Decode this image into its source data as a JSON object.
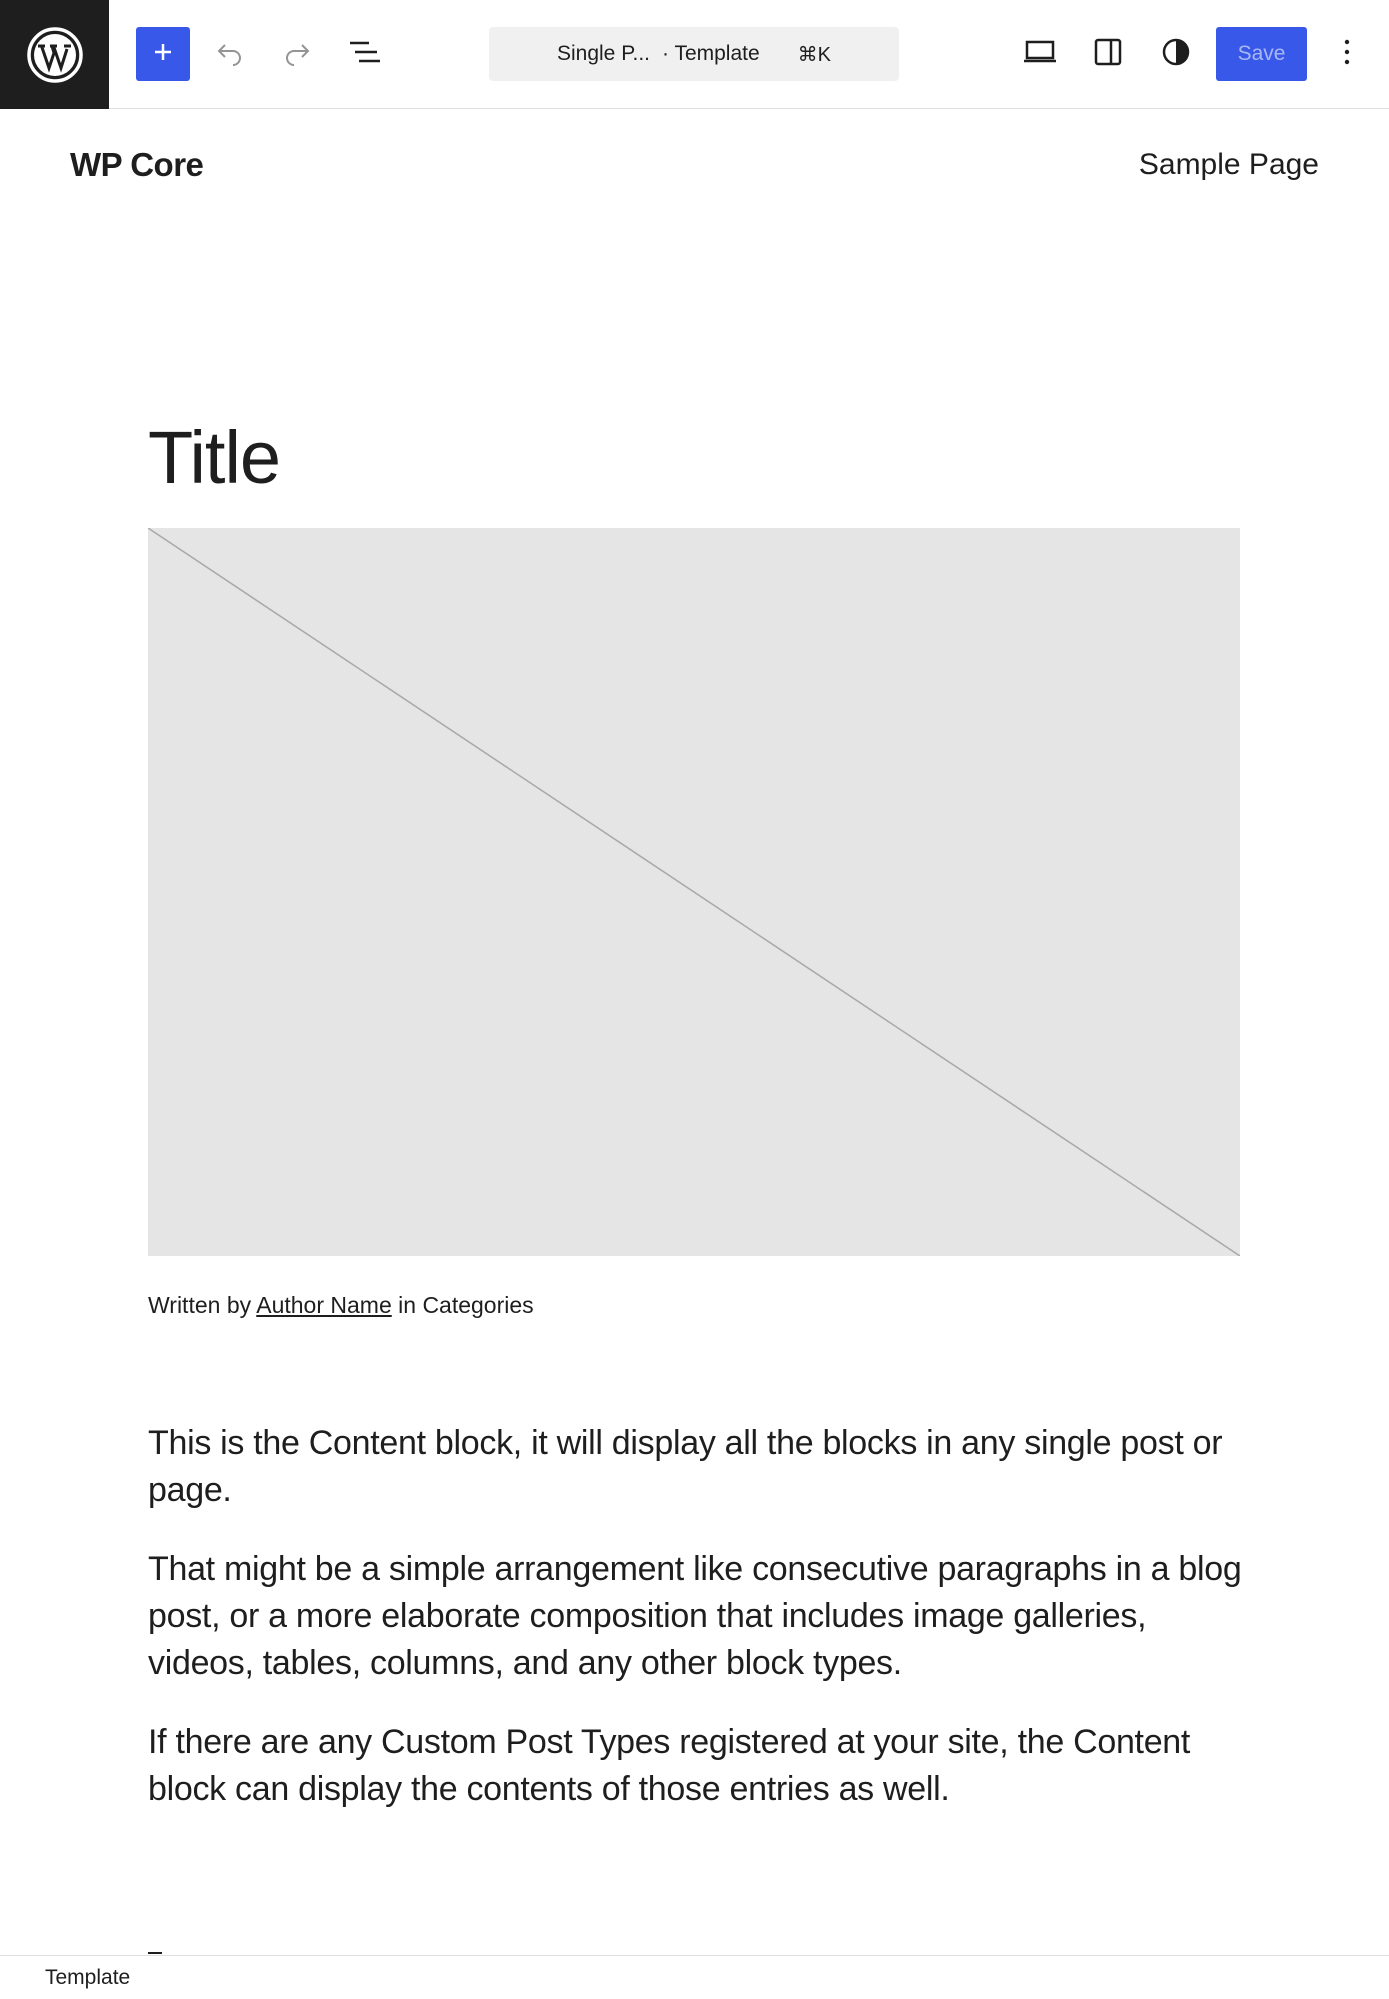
{
  "toolbar": {
    "logo_icon": "wordpress-logo-icon",
    "inserter_icon": "plus-icon",
    "undo_icon": "undo-icon",
    "redo_icon": "redo-icon",
    "list_view_icon": "list-view-icon",
    "command_bar": {
      "doc_title": "Single P...",
      "doc_type": "· Template",
      "shortcut": "⌘K"
    },
    "view_icon": "desktop-view-icon",
    "sidebar_icon": "sidebar-toggle-icon",
    "styles_icon": "styles-contrast-icon",
    "save_label": "Save",
    "options_icon": "more-vertical-icon",
    "accent_color": "#3858e9"
  },
  "site": {
    "title": "WP Core",
    "nav_link": "Sample Page"
  },
  "post": {
    "title": "Title",
    "image_placeholder_color": "#e5e5e5",
    "meta": {
      "prefix": "Written by",
      "author": "Author Name",
      "middle": "in",
      "categories": "Categories"
    },
    "content": [
      "This is the Content block, it will display all the blocks in any single post or page.",
      "That might be a simple arrangement like consecutive paragraphs in a blog post, or a more elaborate composition that includes image galleries, videos, tables, columns, and any other block types.",
      "If there are any Custom Post Types registered at your site, the Content block can display the contents of those entries as well."
    ]
  },
  "statusbar": {
    "breadcrumb": "Template"
  }
}
